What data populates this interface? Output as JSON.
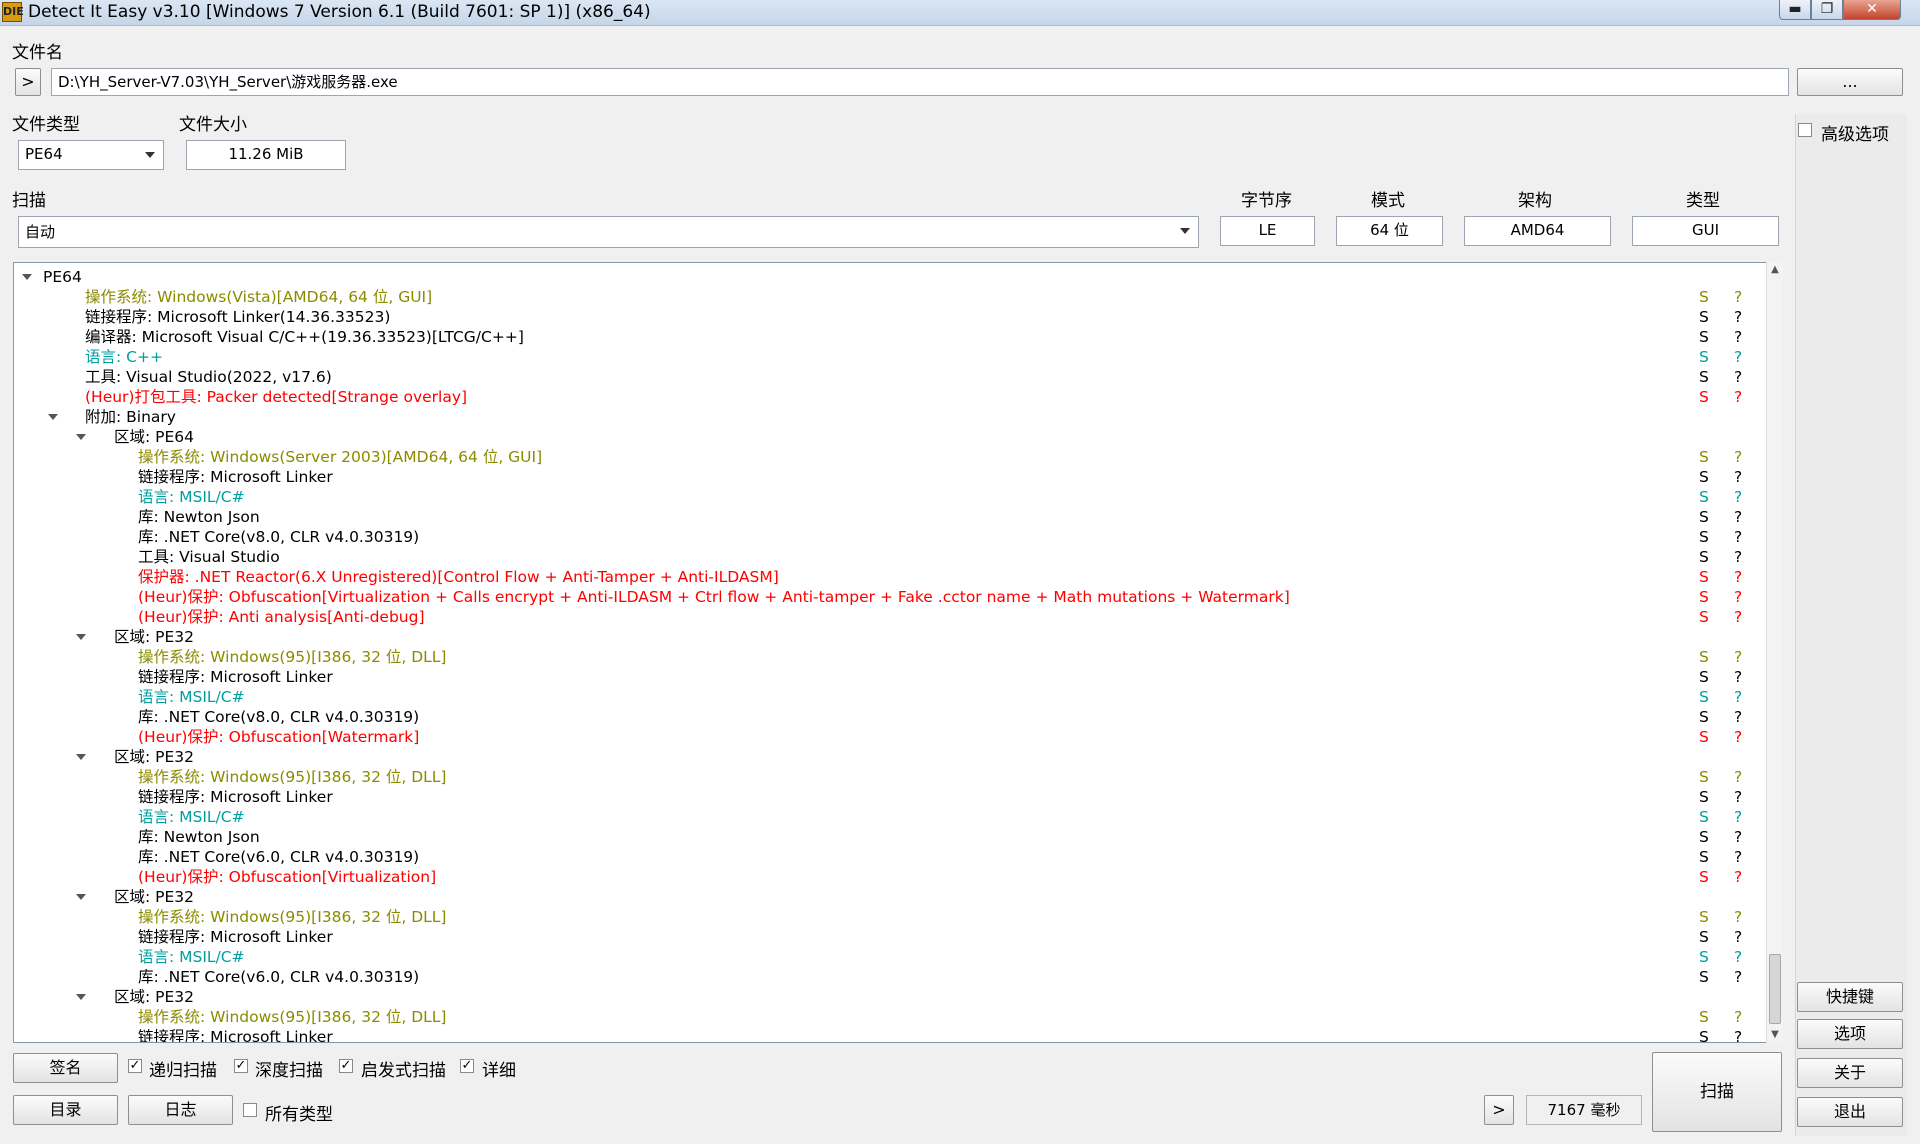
{
  "window": {
    "title": "Detect It Easy v3.10 [Windows 7 Version 6.1 (Build 7601: SP 1)] (x86_64)",
    "icon_label": "DIE",
    "min_glyph": "▬",
    "max_glyph": "❐",
    "close_glyph": "✕"
  },
  "file": {
    "label": "文件名",
    "toggle": ">",
    "path": "D:\\YH_Server-V7.03\\YH_Server\\游戏服务器.exe",
    "browse": "..."
  },
  "filetype": {
    "label": "文件类型",
    "value": "PE64"
  },
  "filesize": {
    "label": "文件大小",
    "value": "11.26 MiB"
  },
  "advanced": {
    "label": "高级选项",
    "checked": false
  },
  "scan": {
    "label": "扫描",
    "mode": "自动",
    "endian_label": "字节序",
    "endian": "LE",
    "mode_label": "模式",
    "bits": "64 位",
    "arch_label": "架构",
    "arch": "AMD64",
    "type_label": "类型",
    "type": "GUI"
  },
  "colors": {
    "os": "#8b8b00",
    "lang": "#009e9e",
    "heur": "#ff0000",
    "normal": "#000000"
  },
  "tree": [
    {
      "indent": 0,
      "exp": true,
      "text": "PE64",
      "color": "normal",
      "flags": false
    },
    {
      "indent": 1,
      "exp": false,
      "text": "操作系统: Windows(Vista)[AMD64, 64 位, GUI]",
      "color": "os",
      "flags": true
    },
    {
      "indent": 1,
      "exp": false,
      "text": "链接程序: Microsoft Linker(14.36.33523)",
      "color": "normal",
      "flags": true
    },
    {
      "indent": 1,
      "exp": false,
      "text": "编译器: Microsoft Visual C/C++(19.36.33523)[LTCG/C++]",
      "color": "normal",
      "flags": true
    },
    {
      "indent": 1,
      "exp": false,
      "text": "语言: C++",
      "color": "lang",
      "flags": true
    },
    {
      "indent": 1,
      "exp": false,
      "text": "工具: Visual Studio(2022, v17.6)",
      "color": "normal",
      "flags": true
    },
    {
      "indent": 1,
      "exp": false,
      "text": "(Heur)打包工具: Packer detected[Strange overlay]",
      "color": "heur",
      "flags": true
    },
    {
      "indent": 1,
      "exp": true,
      "text": "附加: Binary",
      "color": "normal",
      "flags": false
    },
    {
      "indent": 2,
      "exp": true,
      "text": "区域: PE64",
      "color": "normal",
      "flags": false
    },
    {
      "indent": 3,
      "exp": false,
      "text": "操作系统: Windows(Server 2003)[AMD64, 64 位, GUI]",
      "color": "os",
      "flags": true
    },
    {
      "indent": 3,
      "exp": false,
      "text": "链接程序: Microsoft Linker",
      "color": "normal",
      "flags": true
    },
    {
      "indent": 3,
      "exp": false,
      "text": "语言: MSIL/C#",
      "color": "lang",
      "flags": true
    },
    {
      "indent": 3,
      "exp": false,
      "text": "库: Newton Json",
      "color": "normal",
      "flags": true
    },
    {
      "indent": 3,
      "exp": false,
      "text": "库: .NET Core(v8.0, CLR v4.0.30319)",
      "color": "normal",
      "flags": true
    },
    {
      "indent": 3,
      "exp": false,
      "text": "工具: Visual Studio",
      "color": "normal",
      "flags": true
    },
    {
      "indent": 3,
      "exp": false,
      "text": "保护器: .NET Reactor(6.X Unregistered)[Control Flow + Anti-Tamper + Anti-ILDASM]",
      "color": "heur",
      "flags": true
    },
    {
      "indent": 3,
      "exp": false,
      "text": "(Heur)保护: Obfuscation[Virtualization + Calls encrypt + Anti-ILDASM + Ctrl flow + Anti-tamper + Fake .cctor name + Math mutations + Watermark]",
      "color": "heur",
      "flags": true
    },
    {
      "indent": 3,
      "exp": false,
      "text": "(Heur)保护: Anti analysis[Anti-debug]",
      "color": "heur",
      "flags": true
    },
    {
      "indent": 2,
      "exp": true,
      "text": "区域: PE32",
      "color": "normal",
      "flags": false
    },
    {
      "indent": 3,
      "exp": false,
      "text": "操作系统: Windows(95)[I386, 32 位, DLL]",
      "color": "os",
      "flags": true
    },
    {
      "indent": 3,
      "exp": false,
      "text": "链接程序: Microsoft Linker",
      "color": "normal",
      "flags": true
    },
    {
      "indent": 3,
      "exp": false,
      "text": "语言: MSIL/C#",
      "color": "lang",
      "flags": true
    },
    {
      "indent": 3,
      "exp": false,
      "text": "库: .NET Core(v8.0, CLR v4.0.30319)",
      "color": "normal",
      "flags": true
    },
    {
      "indent": 3,
      "exp": false,
      "text": "(Heur)保护: Obfuscation[Watermark]",
      "color": "heur",
      "flags": true
    },
    {
      "indent": 2,
      "exp": true,
      "text": "区域: PE32",
      "color": "normal",
      "flags": false
    },
    {
      "indent": 3,
      "exp": false,
      "text": "操作系统: Windows(95)[I386, 32 位, DLL]",
      "color": "os",
      "flags": true
    },
    {
      "indent": 3,
      "exp": false,
      "text": "链接程序: Microsoft Linker",
      "color": "normal",
      "flags": true
    },
    {
      "indent": 3,
      "exp": false,
      "text": "语言: MSIL/C#",
      "color": "lang",
      "flags": true
    },
    {
      "indent": 3,
      "exp": false,
      "text": "库: Newton Json",
      "color": "normal",
      "flags": true
    },
    {
      "indent": 3,
      "exp": false,
      "text": "库: .NET Core(v6.0, CLR v4.0.30319)",
      "color": "normal",
      "flags": true
    },
    {
      "indent": 3,
      "exp": false,
      "text": "(Heur)保护: Obfuscation[Virtualization]",
      "color": "heur",
      "flags": true
    },
    {
      "indent": 2,
      "exp": true,
      "text": "区域: PE32",
      "color": "normal",
      "flags": false
    },
    {
      "indent": 3,
      "exp": false,
      "text": "操作系统: Windows(95)[I386, 32 位, DLL]",
      "color": "os",
      "flags": true
    },
    {
      "indent": 3,
      "exp": false,
      "text": "链接程序: Microsoft Linker",
      "color": "normal",
      "flags": true
    },
    {
      "indent": 3,
      "exp": false,
      "text": "语言: MSIL/C#",
      "color": "lang",
      "flags": true
    },
    {
      "indent": 3,
      "exp": false,
      "text": "库: .NET Core(v6.0, CLR v4.0.30319)",
      "color": "normal",
      "flags": true
    },
    {
      "indent": 2,
      "exp": true,
      "text": "区域: PE32",
      "color": "normal",
      "flags": false
    },
    {
      "indent": 3,
      "exp": false,
      "text": "操作系统: Windows(95)[I386, 32 位, DLL]",
      "color": "os",
      "flags": true
    },
    {
      "indent": 3,
      "exp": false,
      "text": "链接程序: Microsoft Linker",
      "color": "normal",
      "flags": true
    }
  ],
  "flag_s": "S",
  "flag_q": "?",
  "bottom": {
    "signatures": "签名",
    "recursive": {
      "label": "递归扫描",
      "checked": true
    },
    "deep": {
      "label": "深度扫描",
      "checked": true
    },
    "heuristic": {
      "label": "启发式扫描",
      "checked": true
    },
    "verbose": {
      "label": "详细",
      "checked": true
    },
    "directory": "目录",
    "log": "日志",
    "all_types": {
      "label": "所有类型",
      "checked": false
    },
    "arrow": ">",
    "elapsed": "7167 毫秒",
    "scan": "扫描"
  },
  "side": {
    "shortcuts": "快捷键",
    "options": "选项",
    "about": "关于",
    "exit": "退出"
  },
  "check_glyph": "✓"
}
